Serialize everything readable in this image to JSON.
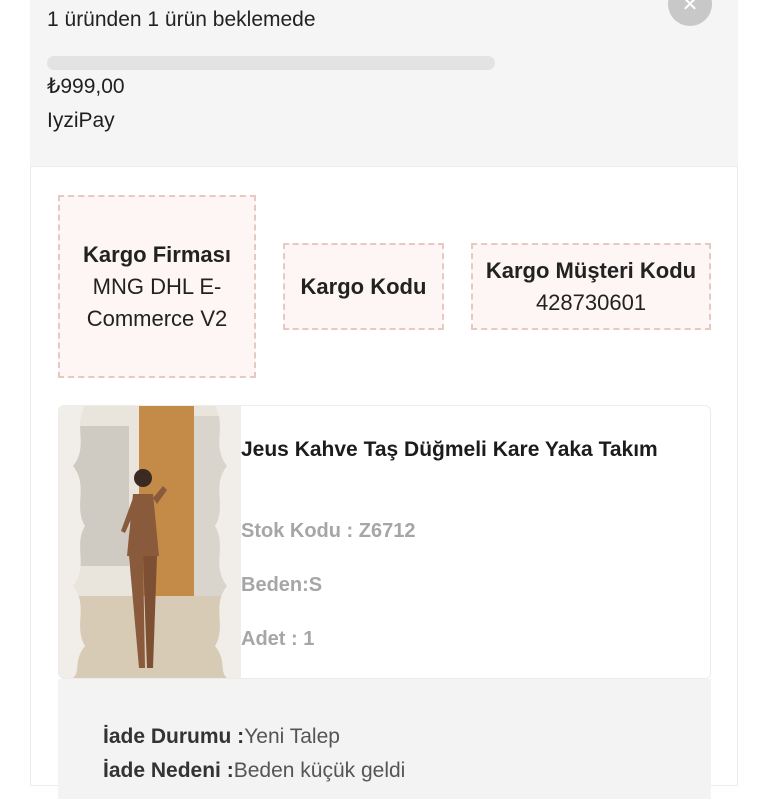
{
  "order": {
    "status_text": "1 üründen 1 ürün beklemede",
    "progress_fraction": 0.0,
    "price": "₺999,00",
    "payment_method": "IyziPay",
    "close_icon": "close-icon"
  },
  "shipping": {
    "company_label": "Kargo Firması",
    "company_value": "MNG DHL E-Commerce V2",
    "code_label": "Kargo Kodu",
    "code_value": "",
    "customer_code_label": "Kargo Müşteri Kodu",
    "customer_code_value": "428730601"
  },
  "product": {
    "title": "Jeus Kahve Taş Düğmeli Kare Yaka Takım",
    "sku": "Stok Kodu : Z6712",
    "size": "Beden:S",
    "quantity": "Adet : 1"
  },
  "return": {
    "status_label": "İade Durumu :",
    "status_value": "Yeni Talep",
    "reason_label": "İade Nedeni :",
    "reason_value": "Beden küçük geldi"
  },
  "colors": {
    "summary_bg": "#f5f5f5",
    "ship_box_bg": "#fdf6f4",
    "ship_box_border": "#e7c9c4",
    "meta_text": "#a6a6a6",
    "product_brown": "#8a5a3c"
  }
}
